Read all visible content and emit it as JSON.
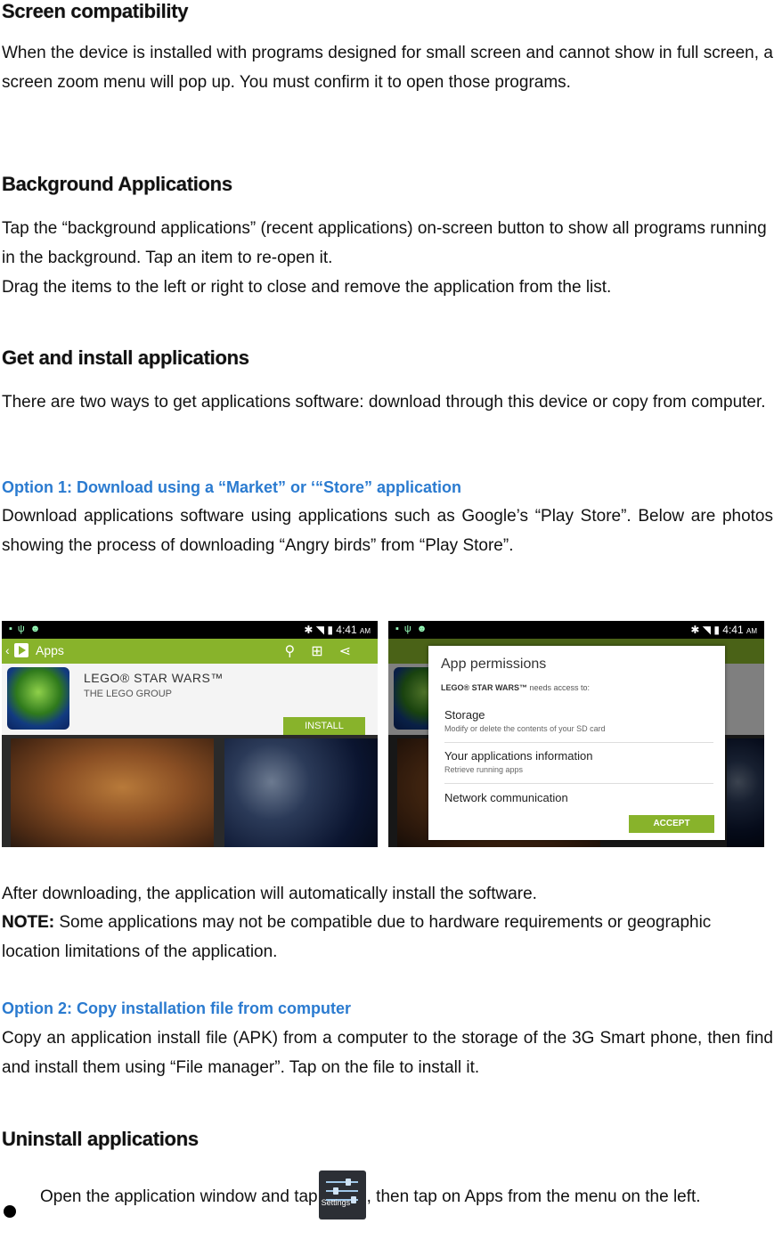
{
  "sections": {
    "screen_compat": {
      "heading": "Screen compatibility",
      "body": "When the device is installed with programs designed for small screen and cannot show in full screen, a screen zoom menu will pop up. You must confirm it to open those programs."
    },
    "background_apps": {
      "heading": "Background Applications",
      "line1": "Tap the “background applications” (recent applications) on-screen button to show all programs running in the background. Tap an item to re-open it.",
      "line2": "Drag the items to the left or right to close and remove the application from the list."
    },
    "get_install": {
      "heading": "Get and install applications",
      "body": "There are two ways to get applications software: download through this device or copy from computer."
    },
    "option1": {
      "heading": "Option 1: Download using a “Market” or ‘“Store” application",
      "body": "Download applications software using applications such as Google’s “Play Store”. Below are photos showing the process of downloading “Angry birds” from “Play Store”."
    },
    "after_download": {
      "line": "After downloading, the application will automatically install the software.",
      "note_label": "NOTE:",
      "note_text": " Some applications may not be compatible due to hardware requirements or geographic location limitations of the application."
    },
    "option2": {
      "heading": "Option 2: Copy installation file from computer",
      "body": "Copy an application install file (APK) from a computer to the storage of the 3G Smart phone, then find and install them using “File manager”. Tap on the file to install it."
    },
    "uninstall": {
      "heading": "Uninstall applications",
      "bullet_before": "Open the application window and tap",
      "bullet_after": ", then tap on Apps from the menu on the left.",
      "settings_icon_label": "Settings"
    }
  },
  "screenshot1": {
    "time": "4:41",
    "ampm": "AM",
    "bar_title": "Apps",
    "app_name": "LEGO® STAR WARS™",
    "developer": "THE LEGO GROUP",
    "install_label": "INSTALL"
  },
  "screenshot2": {
    "time": "4:41",
    "ampm": "AM",
    "dialog_title": "App permissions",
    "needs_app": "LEGO® STAR WARS™",
    "needs_text": " needs access to:",
    "permissions": [
      {
        "title": "Storage",
        "desc": "Modify or delete the contents of your SD card"
      },
      {
        "title": "Your applications information",
        "desc": "Retrieve running apps"
      },
      {
        "title": "Network communication",
        "desc": ""
      }
    ],
    "accept_label": "ACCEPT"
  },
  "colors": {
    "accent_green": "#88b32b",
    "subheading_blue": "#2b7bd0"
  },
  "icons": [
    "back-chevron-icon",
    "play-store-icon",
    "search-icon",
    "wishlist-icon",
    "share-icon",
    "settings-icon",
    "bullet-icon"
  ]
}
